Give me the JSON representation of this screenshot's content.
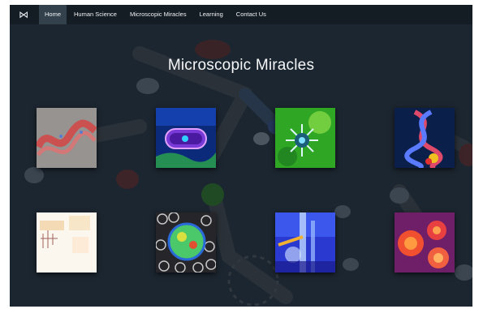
{
  "nav": {
    "logo_icon": "mw-logo-icon",
    "items": [
      {
        "label": "Home",
        "active": true
      },
      {
        "label": "Human Science",
        "active": false
      },
      {
        "label": "Microscopic Miracles",
        "active": false
      },
      {
        "label": "Learning",
        "active": false
      },
      {
        "label": "Contact Us",
        "active": false
      }
    ]
  },
  "page": {
    "title": "Microscopic Miracles"
  },
  "gallery": {
    "images": [
      "red-wave-biology-image",
      "bacterium-cell-image",
      "green-virus-image",
      "dna-helix-image",
      "grid-sketch-image",
      "cell-network-image",
      "lab-glassware-image",
      "red-cells-image"
    ]
  },
  "colors": {
    "background": "#1c2630",
    "navbar": "#141c24",
    "active_tab": "#33414d",
    "text": "#f5f7f8"
  }
}
